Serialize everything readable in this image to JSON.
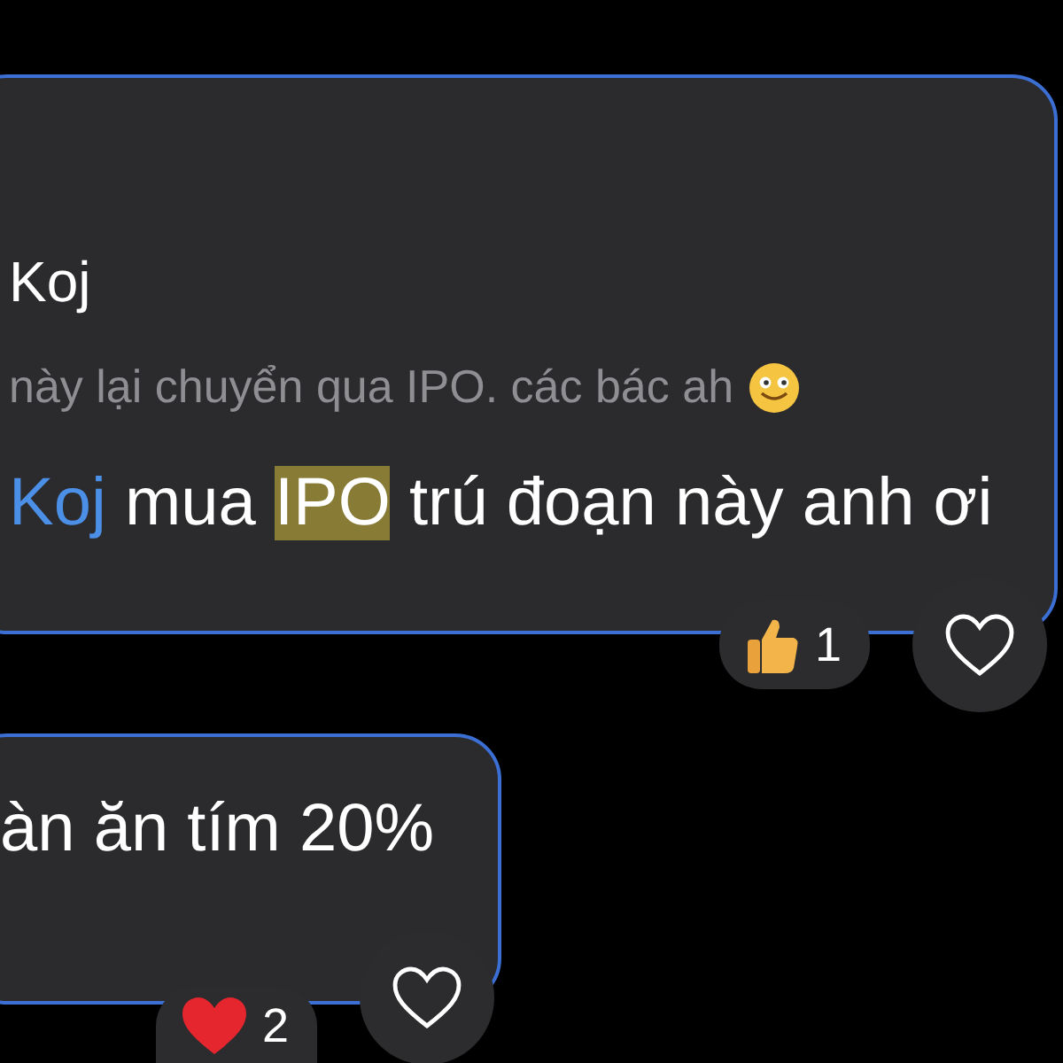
{
  "messages": [
    {
      "author": "Koj",
      "quote": "này lại chuyển qua IPO. các bác ah",
      "quote_emoji": {
        "kind": "smiley"
      },
      "parts": [
        {
          "kind": "mention",
          "text": "Koj"
        },
        {
          "kind": "text",
          "text": " mua "
        },
        {
          "kind": "highlight",
          "text": "IPO"
        },
        {
          "kind": "text",
          "text": " trú đoạn này anh ơi"
        }
      ],
      "reaction": {
        "kind": "thumbs_up",
        "count": "1"
      },
      "liked": false
    },
    {
      "parts": [
        {
          "kind": "text",
          "text": "àn ăn tím 20%"
        }
      ],
      "reaction": {
        "kind": "heart",
        "count": "2"
      },
      "liked": false
    }
  ]
}
